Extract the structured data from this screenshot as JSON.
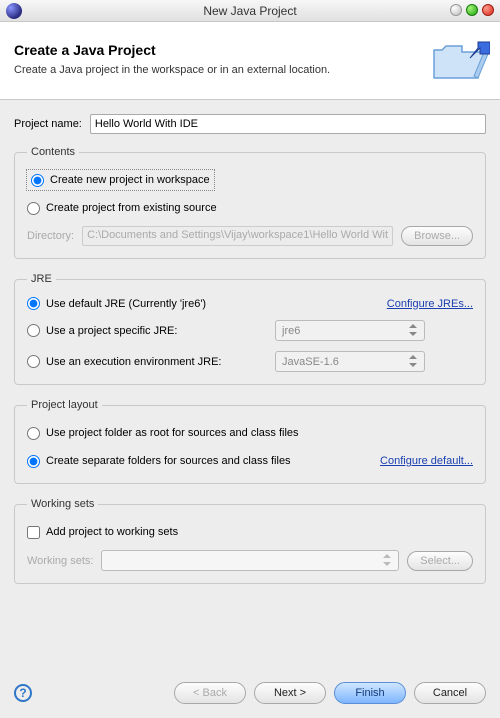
{
  "window": {
    "title": "New Java Project"
  },
  "banner": {
    "heading": "Create a Java Project",
    "subheading": "Create a Java project in the workspace or in an external location."
  },
  "project_name": {
    "label": "Project name:",
    "value": "Hello World With IDE"
  },
  "contents": {
    "legend": "Contents",
    "opt_new": "Create new project in workspace",
    "opt_existing": "Create project from existing source",
    "dir_label": "Directory:",
    "dir_value": "C:\\Documents and Settings\\Vijay\\workspace1\\Hello World Wit",
    "browse": "Browse..."
  },
  "jre": {
    "legend": "JRE",
    "opt_default": "Use default JRE (Currently 'jre6')",
    "configure": "Configure JREs...",
    "opt_specific": "Use a project specific JRE:",
    "specific_value": "jre6",
    "opt_env": "Use an execution environment JRE:",
    "env_value": "JavaSE-1.6"
  },
  "layout": {
    "legend": "Project layout",
    "opt_root": "Use project folder as root for sources and class files",
    "opt_separate": "Create separate folders for sources and class files",
    "configure": "Configure default..."
  },
  "working_sets": {
    "legend": "Working sets",
    "opt_add": "Add project to working sets",
    "label": "Working sets:",
    "select": "Select..."
  },
  "buttons": {
    "back": "< Back",
    "next": "Next >",
    "finish": "Finish",
    "cancel": "Cancel"
  }
}
